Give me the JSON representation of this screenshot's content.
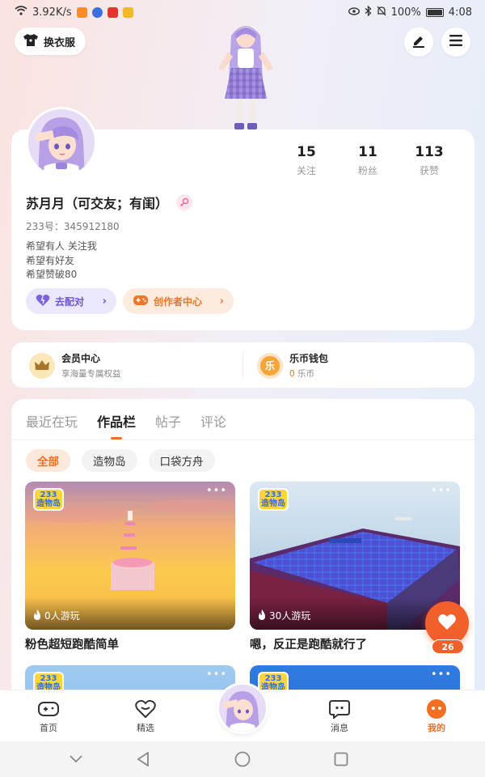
{
  "status_bar": {
    "speed": "3.92K/s",
    "battery_pct": "100%",
    "time": "4:08"
  },
  "header": {
    "outfit_label": "换衣服"
  },
  "profile": {
    "stats": [
      {
        "value": "15",
        "label": "关注"
      },
      {
        "value": "11",
        "label": "粉丝"
      },
      {
        "value": "113",
        "label": "获赞"
      }
    ],
    "username": "苏月月（可交友；有闺）",
    "uid": "233号：345912180",
    "bio": [
      "希望有人 关注我",
      "希望有好友",
      "希望赞破80"
    ],
    "match_label": "去配对",
    "creator_label": "创作者中心"
  },
  "member_center": {
    "title": "会员中心",
    "subtitle": "享海量专属权益"
  },
  "wallet": {
    "title": "乐币钱包",
    "coin_glyph": "乐",
    "balance": "0",
    "unit": "乐币"
  },
  "works": {
    "tabs": [
      "最近在玩",
      "作品栏",
      "帖子",
      "评论"
    ],
    "active_tab": "作品栏",
    "filters": [
      "全部",
      "造物岛",
      "口袋方舟"
    ],
    "active_filter": "全部",
    "games": [
      {
        "title": "粉色超短跑酷简单",
        "plays": "0人游玩",
        "logo": "233 造物岛",
        "more": "•••"
      },
      {
        "title": "嗯，反正是跑酷就行了",
        "plays": "30人游玩",
        "logo": "233 造物岛",
        "more": "•••"
      },
      {
        "title": "",
        "plays": "",
        "logo": "233 造物岛",
        "more": "•••"
      },
      {
        "title": "",
        "plays": "",
        "logo": "233 造物岛",
        "more": "•••"
      }
    ]
  },
  "like_fab": {
    "count": "26"
  },
  "bottom_nav": {
    "items": [
      "首页",
      "精选",
      "消息",
      "我的"
    ],
    "active": "我的"
  },
  "colors": {
    "accent": "#f36f22",
    "match": "#6d54d8",
    "fab": "#f1602a"
  }
}
